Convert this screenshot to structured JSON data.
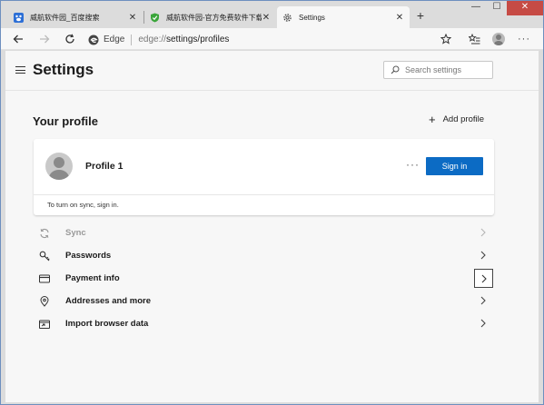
{
  "tabs": [
    {
      "title": "威航软件园_百度搜索",
      "favicon": "baidu-paw-icon",
      "active": false
    },
    {
      "title": "威航软件园-官方免费软件下载_",
      "favicon": "shield-icon",
      "active": false
    },
    {
      "title": "Settings",
      "favicon": "gear-icon",
      "active": true
    }
  ],
  "window_controls": {
    "minimize": "—",
    "maximize": "☐",
    "close": "✕"
  },
  "address_bar": {
    "brand": "Edge",
    "url_proto": "edge://",
    "url_path": "settings/profiles"
  },
  "settings": {
    "title": "Settings",
    "search_placeholder": "Search settings"
  },
  "profile": {
    "section_title": "Your profile",
    "add_profile_label": "Add profile",
    "name": "Profile 1",
    "more_label": "···",
    "signin_label": "Sign in",
    "sync_note": "To turn on sync, sign in."
  },
  "rows": [
    {
      "label": "Sync",
      "icon": "sync-icon",
      "disabled": true
    },
    {
      "label": "Passwords",
      "icon": "key-icon",
      "disabled": false
    },
    {
      "label": "Payment info",
      "icon": "credit-card-icon",
      "disabled": false,
      "focused": true
    },
    {
      "label": "Addresses and more",
      "icon": "location-pin-icon",
      "disabled": false
    },
    {
      "label": "Import browser data",
      "icon": "import-icon",
      "disabled": false
    }
  ],
  "colors": {
    "accent": "#0c6bc4",
    "window_close": "#c64b45"
  }
}
